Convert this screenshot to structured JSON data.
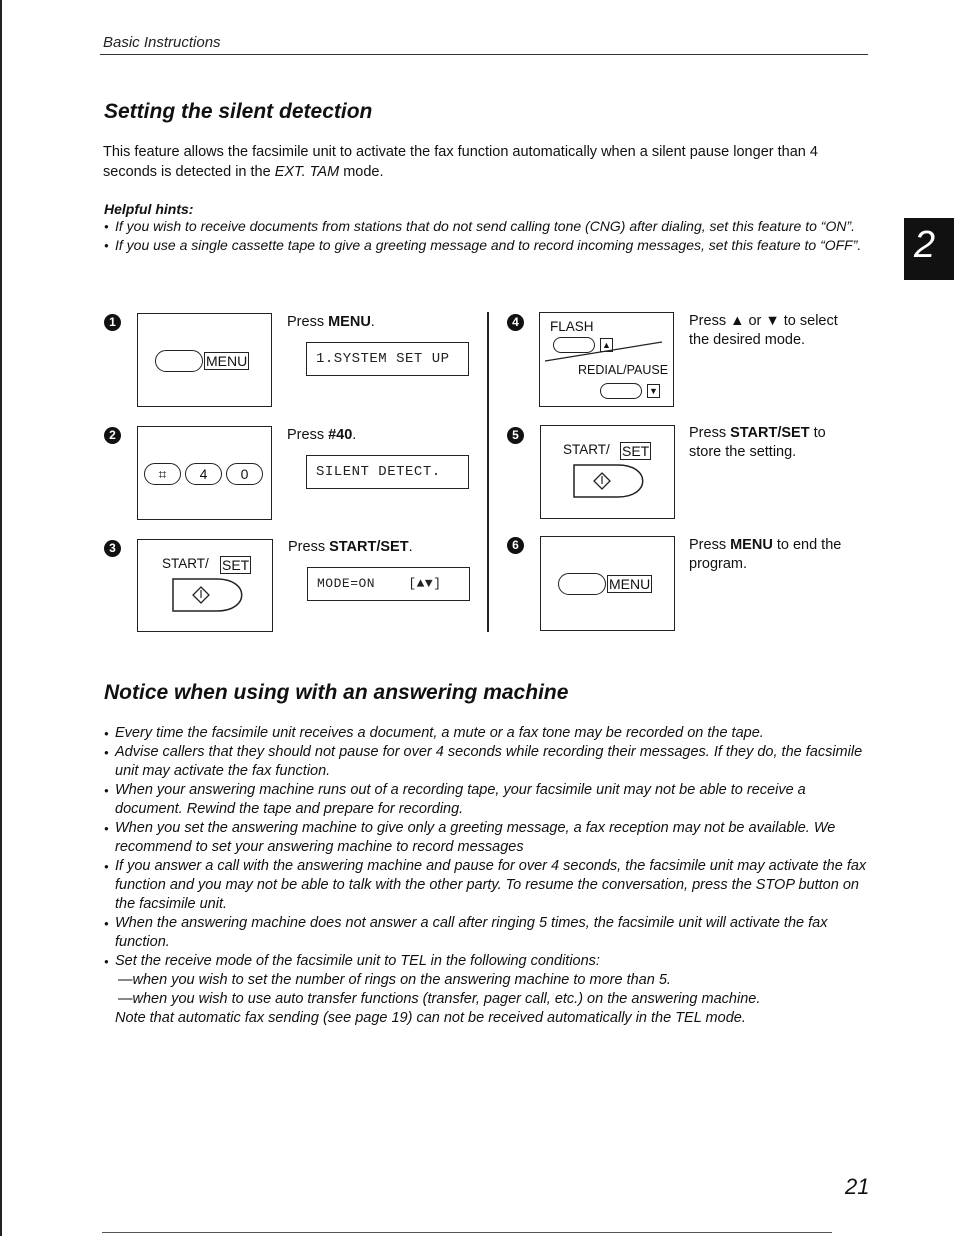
{
  "header": {
    "running_head": "Basic Instructions",
    "chapter_tab": "2"
  },
  "section1": {
    "title": "Setting the silent detection",
    "intro_pre": "This feature allows the facsimile unit to activate the fax function automatically when a silent pause longer than 4 seconds is detected in the ",
    "intro_mode": "EXT. TAM",
    "intro_post": " mode.",
    "hints_title": "Helpful hints:",
    "hints": [
      "If you wish to receive documents from stations that do not send calling tone (CNG) after dialing, set this feature to “ON”.",
      "If you use a single cassette tape to give a greeting message and to record incoming messages, set this feature to “OFF”."
    ]
  },
  "steps": [
    {
      "number": "1",
      "text_pre": "Press ",
      "text_bold": "MENU",
      "text_post": ".",
      "display": "1.SYSTEM SET UP",
      "panel": {
        "button_label": "MENU"
      }
    },
    {
      "number": "2",
      "text_pre": "Press ",
      "text_bold": "#40",
      "text_post": ".",
      "display": "SILENT DETECT.",
      "panel": {
        "keys": [
          "⌗",
          "4",
          "0"
        ]
      }
    },
    {
      "number": "3",
      "text_pre": "Press ",
      "text_bold": "START/SET",
      "text_post": ".",
      "display": "MODE=ON    [▲▼]",
      "panel": {
        "label_prefix": "START/",
        "label_boxed": "SET",
        "symbol": "◇"
      }
    },
    {
      "number": "4",
      "text_pre": "Press ▲ or ▼ to select the desired mode.",
      "text_bold": "",
      "text_post": "",
      "panel": {
        "top_label": "FLASH",
        "top_arrow": "▲",
        "bottom_label": "REDIAL/PAUSE",
        "bottom_arrow": "▼"
      }
    },
    {
      "number": "5",
      "text_pre": "Press ",
      "text_bold": "START/SET",
      "text_post": " to store the setting.",
      "panel": {
        "label_prefix": "START/",
        "label_boxed": "SET",
        "symbol": "◇"
      }
    },
    {
      "number": "6",
      "text_pre": "Press ",
      "text_bold": "MENU",
      "text_post": " to end the program.",
      "panel": {
        "button_label": "MENU"
      }
    }
  ],
  "section2": {
    "title": "Notice when using with an answering machine",
    "bullets": [
      "Every time the facsimile unit receives a document, a mute or a fax tone may be recorded on the tape.",
      "Advise callers that they should not pause for over 4 seconds while recording their messages. If they do, the facsimile unit may activate the fax function.",
      "When your answering machine runs out of a recording tape, your facsimile unit may not be able to receive a document. Rewind the tape and prepare for recording.",
      "When you set the answering machine to give only a greeting message, a fax reception may not be available. We recommend to set your answering machine to record messages",
      "If you answer a call with the answering machine and pause for over 4 seconds, the facsimile unit may activate the fax function and you may not be able to talk with the other party. To resume the conversation, press the STOP button on the facsimile unit.",
      "When the answering machine does not answer a call after ringing 5 times, the facsimile unit will activate the fax function.",
      "Set the receive mode of the facsimile unit to TEL in the following conditions:"
    ],
    "sub_items": [
      "—when you wish to set the number of rings on the answering machine to more than 5.",
      "—when you wish to use auto transfer functions (transfer, pager call, etc.) on the answering machine.",
      "Note that automatic fax sending (see page 19) can not be received automatically in the TEL mode."
    ]
  },
  "footer": {
    "page_number": "21"
  }
}
